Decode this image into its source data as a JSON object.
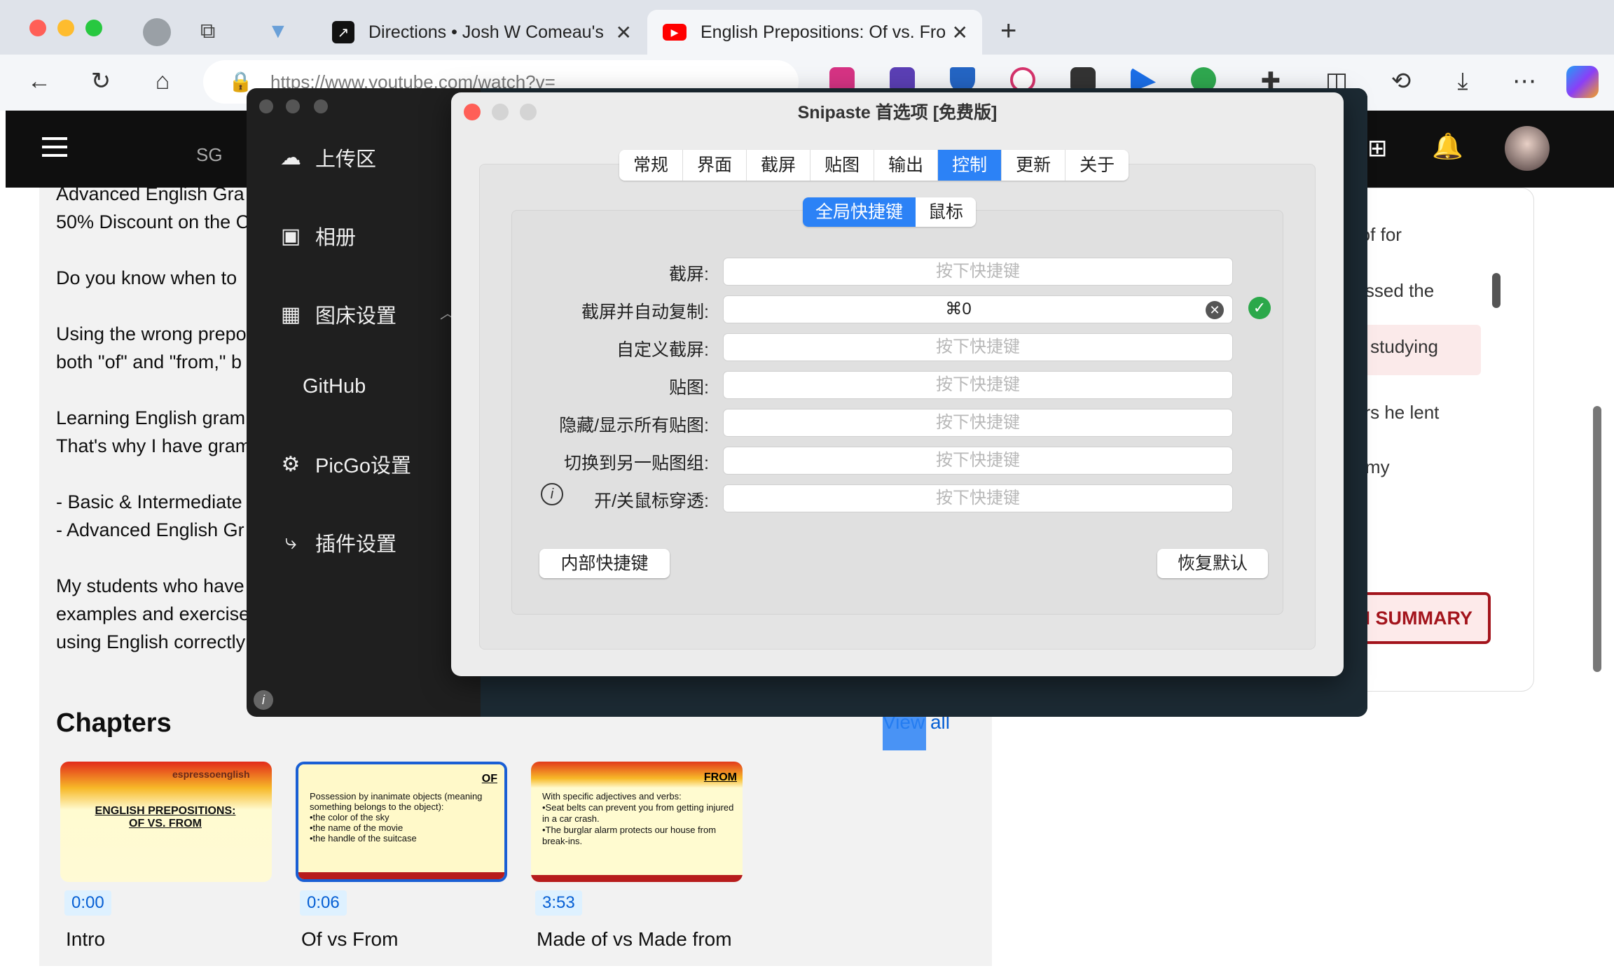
{
  "browser": {
    "tabs": [
      {
        "label": "Directions • Josh W Comeau's"
      },
      {
        "label": "English Prepositions: Of vs. Fro"
      }
    ],
    "url": "https://www.youtube.com/watch?v="
  },
  "youtube": {
    "country": "SG",
    "description_lines": [
      "Advanced English Gra",
      "50% Discount on the C",
      "Do you know when to",
      "Using the wrong prepo",
      "both \"of\" and \"from,\" b",
      "Learning English gram",
      "That's why I have gram",
      " - Basic & Intermediate",
      " - Advanced English Gr",
      "My students who have",
      "examples and exercise",
      "using English correctly"
    ],
    "chapters_title": "Chapters",
    "view_all": "View all",
    "chapters": [
      {
        "time": "0:00",
        "title": "Intro",
        "thumb_heading": "ENGLISH PREPOSITIONS: OF VS. FROM",
        "thumb_brand": "espressoenglish"
      },
      {
        "time": "0:06",
        "title": "Of vs From",
        "thumb_tag": "OF",
        "thumb_text": [
          "Possession by inanimate objects (meaning something belongs to the object):",
          "•the color of the sky",
          "•the name of the movie",
          "•the handle of the suitcase"
        ]
      },
      {
        "time": "3:53",
        "title": "Made of vs Made from",
        "thumb_tag": "FROM",
        "thumb_text": [
          "With specific adjectives and verbs:",
          "•Seat belts can prevent you from getting injured in a car crash.",
          "•The burglar alarm protects our house from break-ins."
        ]
      }
    ],
    "side_snippets": [
      "e of for",
      "passed the",
      "ne studying",
      "yers he lent",
      "of my"
    ],
    "summary_button": "I SUMMARY"
  },
  "picgo": {
    "menu": [
      {
        "label": "上传区",
        "icon": "cloud-upload-icon"
      },
      {
        "label": "相册",
        "icon": "image-icon"
      },
      {
        "label": "图床设置",
        "icon": "grid-icon"
      },
      {
        "label": "GitHub",
        "icon": ""
      },
      {
        "label": "PicGo设置",
        "icon": "gear-icon"
      },
      {
        "label": "插件设置",
        "icon": "share-icon"
      }
    ]
  },
  "snipaste": {
    "title": "Snipaste 首选项 [免费版]",
    "tabs": [
      "常规",
      "界面",
      "截屏",
      "贴图",
      "输出",
      "控制",
      "更新",
      "关于"
    ],
    "active_tab": "控制",
    "subtabs": [
      "全局快捷键",
      "鼠标"
    ],
    "placeholder": "按下快捷键",
    "shortcuts": [
      {
        "label": "截屏:",
        "value": ""
      },
      {
        "label": "截屏并自动复制:",
        "value": "⌘0"
      },
      {
        "label": "自定义截屏:",
        "value": ""
      },
      {
        "label": "贴图:",
        "value": ""
      },
      {
        "label": "隐藏/显示所有贴图:",
        "value": ""
      },
      {
        "label": "切换到另一贴图组:",
        "value": ""
      },
      {
        "label": "开/关鼠标穿透:",
        "value": ""
      }
    ],
    "internal_button": "内部快捷键",
    "restore_button": "恢复默认"
  }
}
